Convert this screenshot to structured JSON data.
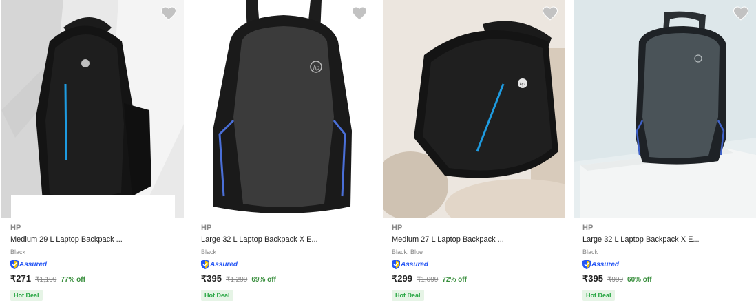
{
  "products": [
    {
      "brand": "HP",
      "title": "Medium 29 L Laptop Backpack ...",
      "color": "Black",
      "assured": "Assured",
      "price": "₹271",
      "mrp": "₹1,199",
      "off": "77% off",
      "deal": "Hot Deal"
    },
    {
      "brand": "HP",
      "title": "Large 32 L Laptop Backpack X E...",
      "color": "Black",
      "assured": "Assured",
      "price": "₹395",
      "mrp": "₹1,299",
      "off": "69% off",
      "deal": "Hot Deal"
    },
    {
      "brand": "HP",
      "title": "Medium 27 L Laptop Backpack ...",
      "color": "Black, Blue",
      "assured": "Assured",
      "price": "₹299",
      "mrp": "₹1,099",
      "off": "72% off",
      "deal": "Hot Deal"
    },
    {
      "brand": "HP",
      "title": "Large 32 L Laptop Backpack X E...",
      "color": "Black",
      "assured": "Assured",
      "price": "₹395",
      "mrp": "₹999",
      "off": "60% off",
      "deal": "Hot Deal"
    }
  ],
  "icons": {
    "wishlist": "heart-icon",
    "assured": "shield-check-icon",
    "logo": "hp-logo-icon"
  },
  "colors": {
    "accent_blue": "#2455f4",
    "offer_green": "#388e3c",
    "deal_bg": "#e6f4e6",
    "heart_grey": "#c2c2c2",
    "stripe_blue": "#1e9be0"
  }
}
